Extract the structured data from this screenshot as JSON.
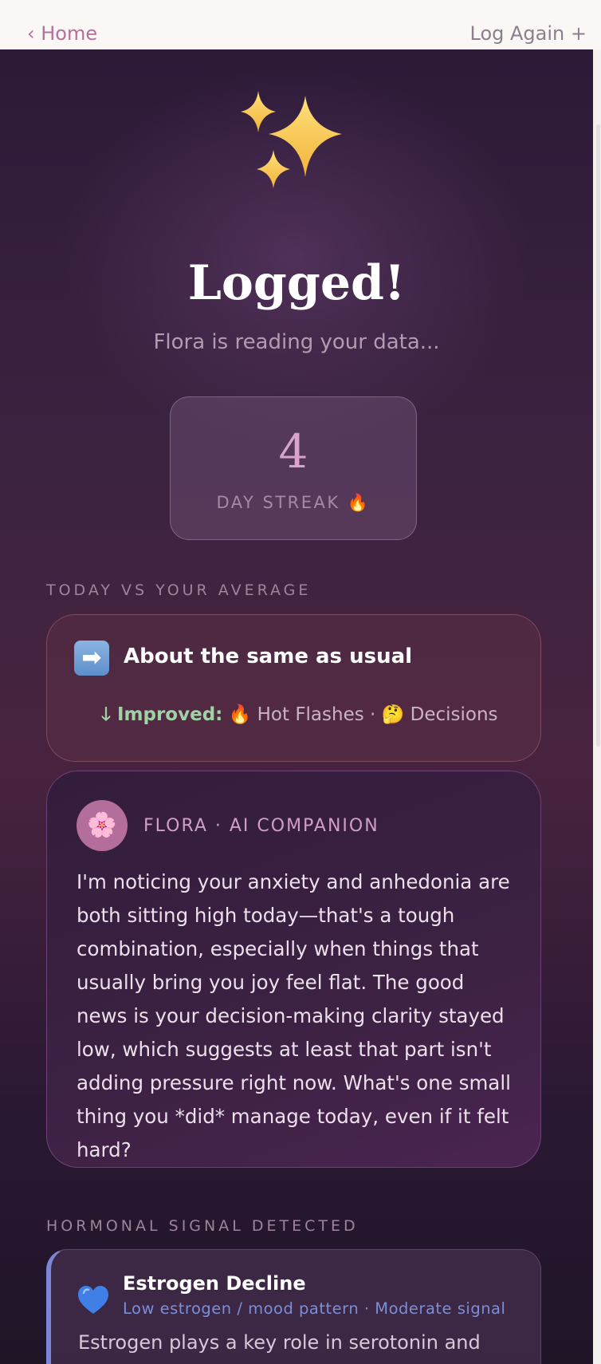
{
  "nav": {
    "home_label": "‹ Home",
    "log_again_label": "Log Again +"
  },
  "hero": {
    "title": "Logged!",
    "subtitle": "Flora is reading your data..."
  },
  "streak": {
    "count": "4",
    "label": "DAY STREAK 🔥"
  },
  "comparison": {
    "section_label": "TODAY VS YOUR AVERAGE",
    "icon": "➡",
    "summary": "About the same as usual",
    "improved_prefix": "🡓 Improved:",
    "improved_items": "🔥 Hot Flashes · 🤔 Decisions"
  },
  "flora": {
    "avatar": "🌸",
    "label": "FLORA · AI COMPANION",
    "message": "I'm noticing your anxiety and anhedonia are both sitting high today—that's a tough combination, especially when things that usually bring you joy feel flat. The good news is your decision-making clarity stayed low, which suggests at least that part isn't adding pressure right now. What's one small thing you *did* manage today, even if it felt hard?"
  },
  "hormonal": {
    "section_label": "HORMONAL SIGNAL DETECTED",
    "title": "Estrogen Decline",
    "subtitle": "Low estrogen / mood pattern · Moderate signal",
    "body": "Estrogen plays a key role in serotonin and",
    "icon": "blue-heart-icon",
    "accent_color": "#7c86d6"
  }
}
